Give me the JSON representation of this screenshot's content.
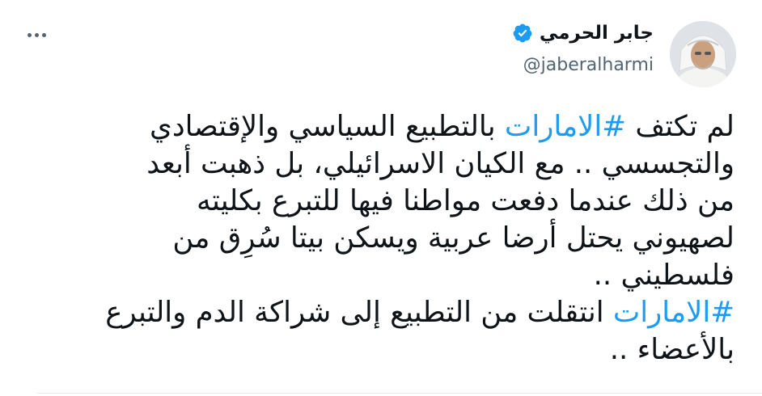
{
  "author": {
    "display_name": "جابر الحرمي",
    "handle": "@jaberalharmi",
    "verified": true,
    "verified_icon": "verified-badge-icon",
    "avatar_icon": "avatar"
  },
  "menu": {
    "icon": "more-options-icon"
  },
  "tweet": {
    "lines": [
      {
        "pre": "لم تكتف ",
        "tag": "#الامارات",
        "post": " بالتطبيع السياسي والإقتصادي"
      },
      {
        "pre": "والتجسسي .. مع الكيان الاسرائيلي، بل ذهبت أبعد",
        "tag": "",
        "post": ""
      },
      {
        "pre": "من ذلك عندما دفعت مواطنا فيها للتبرع بكليته",
        "tag": "",
        "post": ""
      },
      {
        "pre": "لصهيوني يحتل أرضا عربية ويسكن بيتا سُرِق من",
        "tag": "",
        "post": ""
      },
      {
        "pre": "فلسطيني ..",
        "tag": "",
        "post": ""
      },
      {
        "pre": "",
        "tag": "#الامارات",
        "post": " انتقلت من التطبيع إلى شراكة الدم والتبرع"
      },
      {
        "pre": "بالأعضاء ..",
        "tag": "",
        "post": ""
      }
    ]
  },
  "colors": {
    "text": "#0f1419",
    "secondary": "#536471",
    "link": "#1d9bf0",
    "verified": "#1d9bf0"
  }
}
